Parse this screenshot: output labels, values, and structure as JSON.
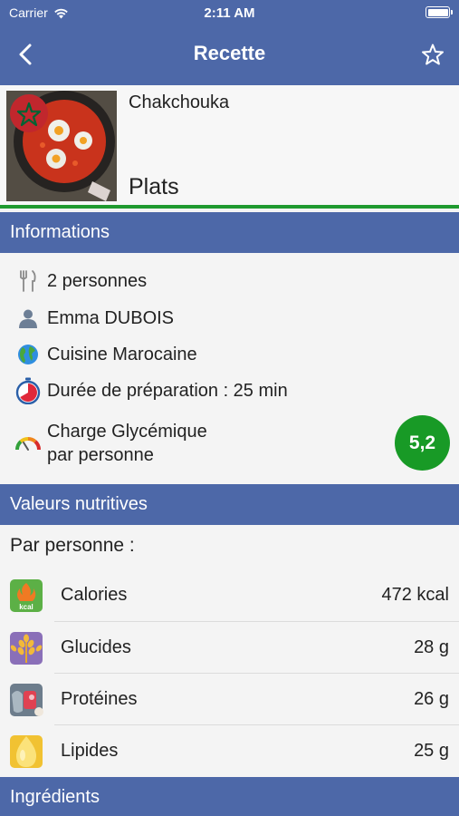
{
  "status_bar": {
    "carrier": "Carrier",
    "time": "2:11 AM"
  },
  "nav": {
    "title": "Recette",
    "back_icon": "chevron-left-icon",
    "favorite_icon": "star-outline-icon"
  },
  "recipe": {
    "name": "Chakchouka",
    "category": "Plats",
    "flag": "morocco-flag",
    "accent_color": "#1f9a2f"
  },
  "informations": {
    "title": "Informations",
    "servings": "2 personnes",
    "author": "Emma DUBOIS",
    "cuisine": "Cuisine Marocaine",
    "duration": "Durée de préparation : 25 min",
    "glycemic_label_1": "Charge Glycémique",
    "glycemic_label_2": "par personne",
    "glycemic_value": "5,2"
  },
  "nutrition": {
    "title": "Valeurs nutritives",
    "subtitle": "Par personne :",
    "items": [
      {
        "label": "Calories",
        "value": "472 kcal",
        "icon": "kcal-flame-icon"
      },
      {
        "label": "Glucides",
        "value": "28 g",
        "icon": "wheat-icon"
      },
      {
        "label": "Protéines",
        "value": "26 g",
        "icon": "fish-meat-icon"
      },
      {
        "label": "Lipides",
        "value": "25 g",
        "icon": "oil-drop-icon"
      }
    ]
  },
  "ingredients": {
    "title": "Ingrédients"
  },
  "colors": {
    "header": "#4d68a8",
    "badge": "#189a26"
  }
}
